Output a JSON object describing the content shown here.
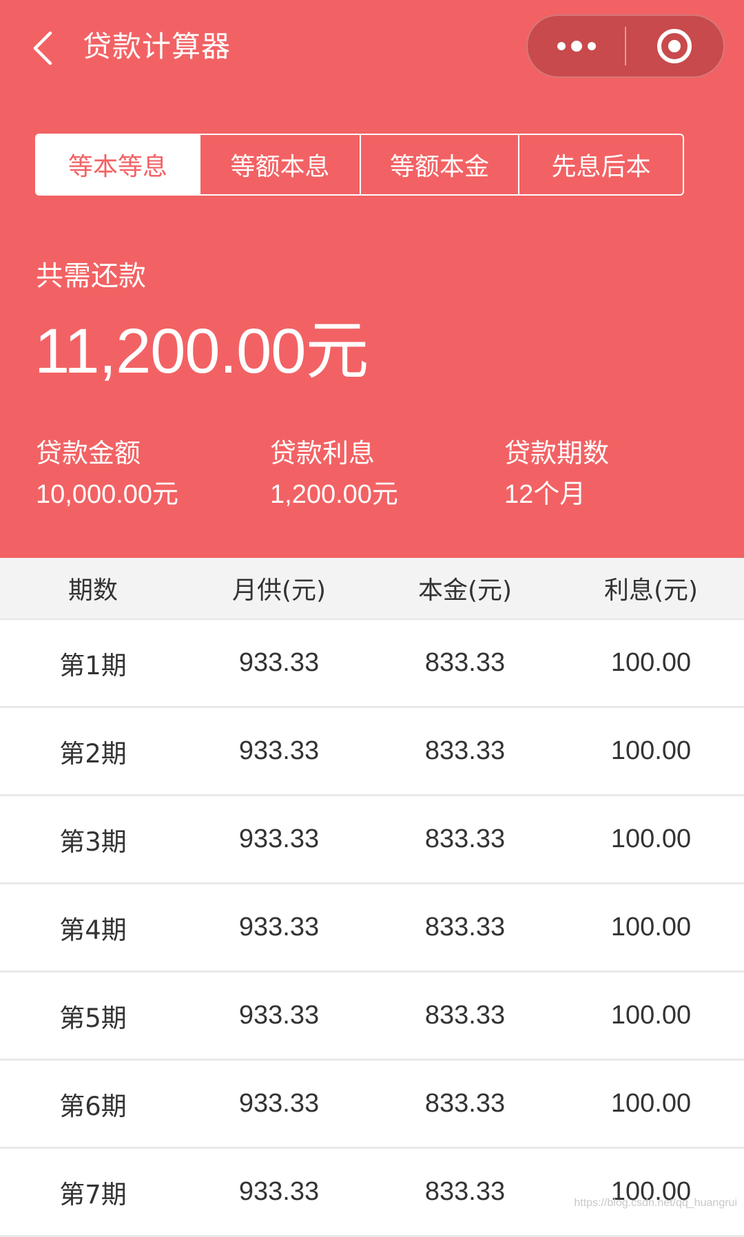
{
  "colors": {
    "primary": "#f26264",
    "capsule": "#c84a4c",
    "table_header_bg": "#f3f3f3",
    "text_dark": "#333333"
  },
  "header": {
    "title": "贷款计算器",
    "back_icon": "chevron-left-icon",
    "more_icon": "more-dots-icon",
    "close_icon": "target-circle-icon"
  },
  "tabs": [
    {
      "label": "等本等息",
      "active": true
    },
    {
      "label": "等额本息",
      "active": false
    },
    {
      "label": "等额本金",
      "active": false
    },
    {
      "label": "先息后本",
      "active": false
    }
  ],
  "summary": {
    "total_label": "共需还款",
    "total_amount": "11,200.00元",
    "stats": [
      {
        "label": "贷款金额",
        "value": "10,000.00元"
      },
      {
        "label": "贷款利息",
        "value": "1,200.00元"
      },
      {
        "label": "贷款期数",
        "value": "12个月"
      }
    ]
  },
  "table": {
    "headers": [
      "期数",
      "月供(元)",
      "本金(元)",
      "利息(元)"
    ],
    "rows": [
      [
        "第1期",
        "933.33",
        "833.33",
        "100.00"
      ],
      [
        "第2期",
        "933.33",
        "833.33",
        "100.00"
      ],
      [
        "第3期",
        "933.33",
        "833.33",
        "100.00"
      ],
      [
        "第4期",
        "933.33",
        "833.33",
        "100.00"
      ],
      [
        "第5期",
        "933.33",
        "833.33",
        "100.00"
      ],
      [
        "第6期",
        "933.33",
        "833.33",
        "100.00"
      ],
      [
        "第7期",
        "933.33",
        "833.33",
        "100.00"
      ]
    ]
  },
  "watermark": "https://blog.csdn.net/qq_huangrui"
}
